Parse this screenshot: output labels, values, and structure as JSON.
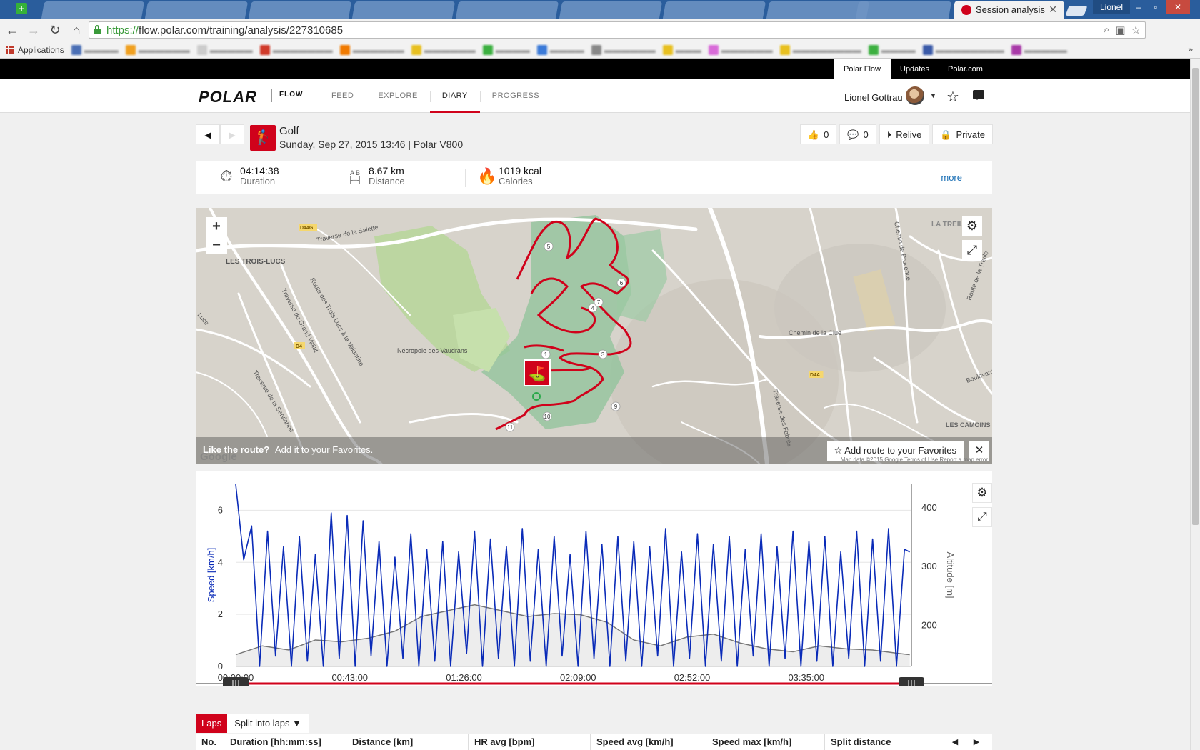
{
  "browser": {
    "active_tab": "Session analysis",
    "user": "Lionel",
    "url_https": "https://",
    "url_rest": "flow.polar.com/training/analysis/227310685",
    "bookmarks_label": "Applications"
  },
  "topnav": [
    "Polar Flow",
    "Updates",
    "Polar.com"
  ],
  "header": {
    "logo": "POLAR",
    "logo_sub": "FLOW",
    "nav": [
      "FEED",
      "EXPLORE",
      "DIARY",
      "PROGRESS"
    ],
    "active_nav": "DIARY",
    "user_name": "Lionel Gottrau"
  },
  "session": {
    "sport": "Golf",
    "subtitle": "Sunday, Sep 27, 2015 13:46 | Polar V800",
    "likes": "0",
    "comments": "0",
    "relive": "Relive",
    "privacy": "Private"
  },
  "summary": {
    "duration_value": "04:14:38",
    "duration_label": "Duration",
    "distance_value": "8.67 km",
    "distance_label": "Distance",
    "calories_value": "1019 kcal",
    "calories_label": "Calories",
    "more": "more",
    "distance_ab_a": "A",
    "distance_ab_b": "B"
  },
  "map": {
    "fav_question": "Like the route?",
    "fav_hint": "Add it to your Favorites.",
    "fav_button": "Add route to your Favorites",
    "google": "Google",
    "attribution": "Map data ©2015 Google   Terms of Use   Report a map error",
    "labels": [
      "LES TROIS-LUCS",
      "Nécropole des Vaudrans",
      "Chemin de la Clue",
      "LES CAMOINS",
      "LA TREILLE",
      "D44G",
      "D4",
      "D4A",
      "Traverse de la Salette",
      "Route des Trois Lucs à la Valentine",
      "Traverse du Grand Vallat",
      "Traverse de la Servianne",
      "Chemin de Provence",
      "Route de la Treille",
      "Traverse des Fabres",
      "Boulevard",
      "Luce"
    ],
    "lap_markers": [
      "1",
      "3",
      "4",
      "5",
      "6",
      "7",
      "9",
      "10",
      "11"
    ]
  },
  "chart_data": {
    "type": "line",
    "ylabel": "Speed [km/h]",
    "y2label": "Altitude [m]",
    "ylim": [
      0,
      7
    ],
    "y2lim": [
      130,
      440
    ],
    "yticks": [
      "0",
      "2",
      "4",
      "6"
    ],
    "y2ticks": [
      "200",
      "300",
      "400"
    ],
    "xticks": [
      "00:00:00",
      "00:43:00",
      "01:26:00",
      "02:09:00",
      "02:52:00",
      "03:35:00"
    ],
    "xlim_seconds": [
      0,
      15278
    ],
    "speed_color": "#0a2bb8",
    "altitude_color": "#777777",
    "series": [
      {
        "name": "Speed",
        "x_minutes": [
          0,
          3,
          6,
          9,
          12,
          15,
          18,
          21,
          24,
          27,
          30,
          33,
          36,
          39,
          42,
          45,
          48,
          51,
          54,
          57,
          60,
          63,
          66,
          69,
          72,
          75,
          78,
          81,
          84,
          87,
          90,
          93,
          96,
          99,
          102,
          105,
          108,
          111,
          114,
          117,
          120,
          123,
          126,
          129,
          132,
          135,
          138,
          141,
          144,
          147,
          150,
          153,
          156,
          159,
          162,
          165,
          168,
          171,
          174,
          177,
          180,
          183,
          186,
          189,
          192,
          195,
          198,
          201,
          204,
          207,
          210,
          213,
          216,
          219,
          222,
          225,
          228,
          231,
          234,
          237,
          240,
          243,
          246,
          249,
          252,
          254
        ],
        "values": [
          7.0,
          4.1,
          5.4,
          0.0,
          5.2,
          0.4,
          4.6,
          0.0,
          5.0,
          0.2,
          4.3,
          0.0,
          5.9,
          0.3,
          5.8,
          0.0,
          5.6,
          0.4,
          4.8,
          0.0,
          4.2,
          0.3,
          5.1,
          0.0,
          4.5,
          0.2,
          4.8,
          0.0,
          4.4,
          0.5,
          5.2,
          0.0,
          4.9,
          0.3,
          4.6,
          0.0,
          5.3,
          0.2,
          4.5,
          0.0,
          5.0,
          0.4,
          4.3,
          0.0,
          5.2,
          0.3,
          4.7,
          0.0,
          5.0,
          0.2,
          4.8,
          0.0,
          4.6,
          0.4,
          5.3,
          0.0,
          4.4,
          0.3,
          5.1,
          0.0,
          4.7,
          0.2,
          5.0,
          0.0,
          4.5,
          0.4,
          5.1,
          0.0,
          4.6,
          0.3,
          5.2,
          0.0,
          4.8,
          0.2,
          5.0,
          0.0,
          4.4,
          0.3,
          5.2,
          0.0,
          4.9,
          0.2,
          5.3,
          0.0,
          4.5,
          4.4
        ]
      },
      {
        "name": "Altitude",
        "x_minutes": [
          0,
          10,
          20,
          30,
          40,
          50,
          60,
          70,
          80,
          90,
          100,
          110,
          120,
          130,
          140,
          150,
          160,
          170,
          180,
          190,
          200,
          210,
          220,
          230,
          240,
          250,
          254
        ],
        "values": [
          150,
          165,
          158,
          175,
          172,
          178,
          190,
          215,
          225,
          235,
          225,
          215,
          220,
          218,
          205,
          175,
          165,
          180,
          185,
          170,
          160,
          155,
          165,
          160,
          158,
          152,
          150
        ]
      }
    ]
  },
  "laps": {
    "tab": "Laps",
    "split": "Split into laps",
    "columns": [
      "No.",
      "Duration [hh:mm:ss]",
      "Distance [km]",
      "HR avg [bpm]",
      "Speed avg [km/h]",
      "Speed max [km/h]",
      "Split distance"
    ]
  }
}
